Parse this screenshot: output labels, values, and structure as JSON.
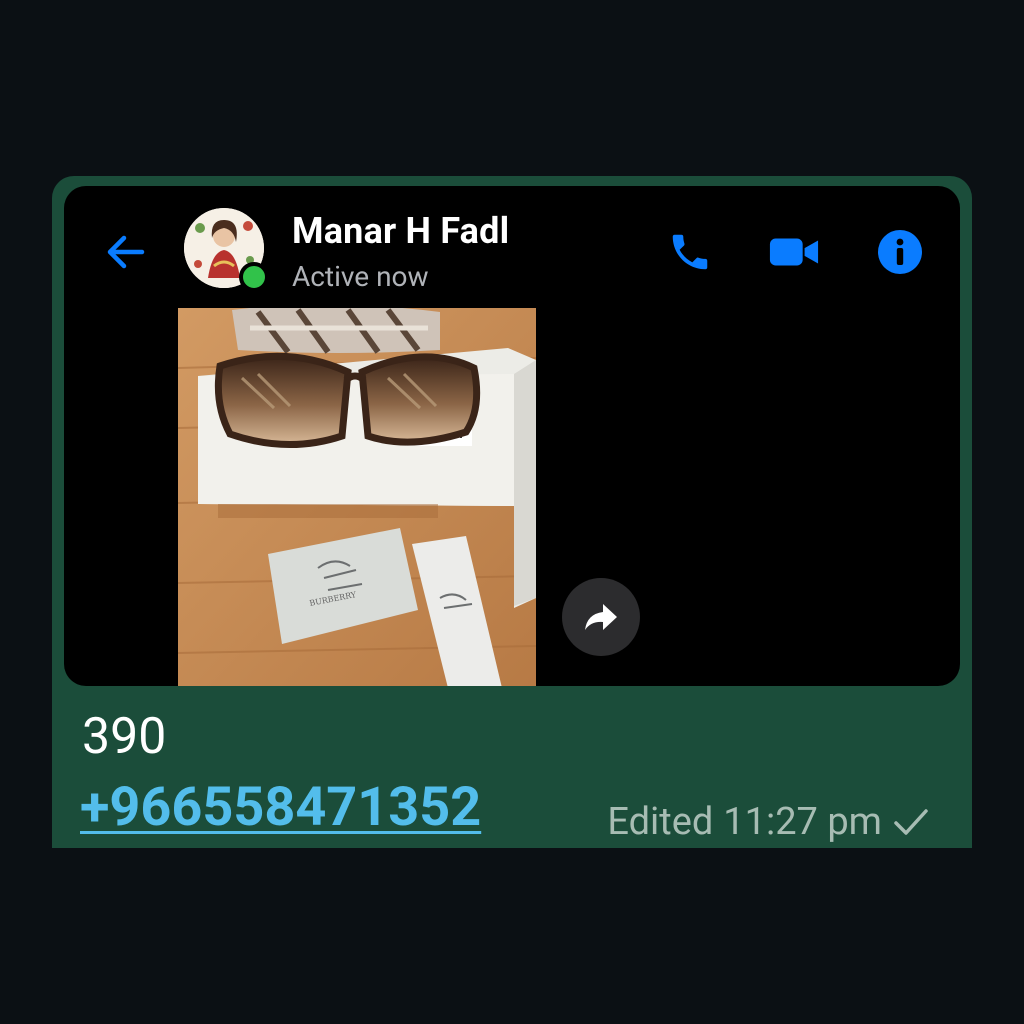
{
  "header": {
    "contact_name": "Manar H Fadl",
    "status": "Active now"
  },
  "icons": {
    "back": "arrow-left-icon",
    "call": "phone-icon",
    "video": "video-camera-icon",
    "info": "info-icon",
    "share": "share-arrow-icon",
    "read": "check-icon"
  },
  "message": {
    "text": "390",
    "phone": "+966558471352",
    "edited_label": "Edited",
    "time": "11:27 pm"
  },
  "colors": {
    "messenger_accent": "#0a7cff",
    "bubble_green": "#1b4d3a",
    "link_blue": "#53bdeb",
    "presence_green": "#31c24a"
  }
}
